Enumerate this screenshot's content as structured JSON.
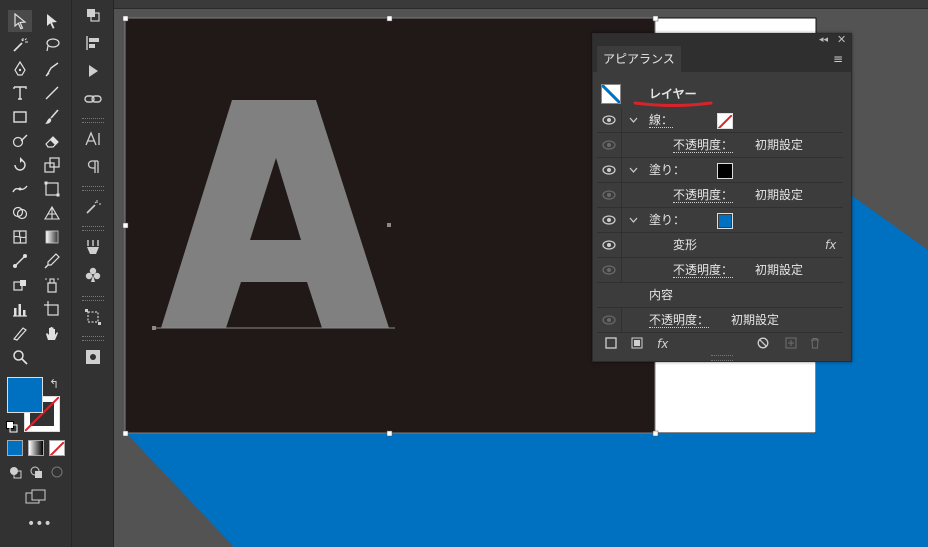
{
  "panel": {
    "tab_label": "アピアランス",
    "layer_label": "レイヤー",
    "rows": {
      "stroke_label": "線：",
      "opacity_label": "不透明度：",
      "opacity_value": "初期設定",
      "fill_label": "塗り：",
      "transform_label": "変形",
      "fx_label": "fx",
      "contents_label": "内容"
    }
  },
  "canvas": {
    "glyph": "A"
  },
  "colors": {
    "artboard": "#211818",
    "glyph": "#808080",
    "accent_blue": "#0070c0",
    "annotation_red": "#d9232a"
  }
}
